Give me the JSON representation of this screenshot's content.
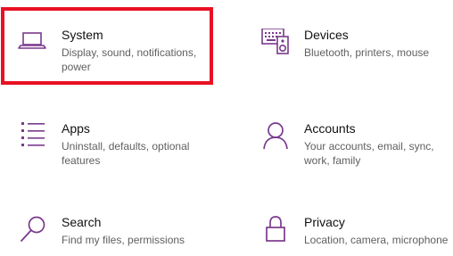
{
  "accent_color": "#7a3a8c",
  "highlight_color": "#e81123",
  "tiles": [
    {
      "title": "System",
      "desc_line1": "Display, sound, notifications,",
      "desc_line2": "power",
      "icon": "laptop-icon"
    },
    {
      "title": "Devices",
      "desc_line1": "Bluetooth, printers, mouse",
      "desc_line2": "",
      "icon": "keyboard-speaker-icon"
    },
    {
      "title": "Apps",
      "desc_line1": "Uninstall, defaults, optional",
      "desc_line2": "features",
      "icon": "apps-list-icon"
    },
    {
      "title": "Accounts",
      "desc_line1": "Your accounts, email, sync,",
      "desc_line2": "work, family",
      "icon": "person-icon"
    },
    {
      "title": "Search",
      "desc_line1": "Find my files, permissions",
      "desc_line2": "",
      "icon": "magnifier-icon"
    },
    {
      "title": "Privacy",
      "desc_line1": "Location, camera, microphone",
      "desc_line2": "",
      "icon": "lock-icon"
    }
  ]
}
